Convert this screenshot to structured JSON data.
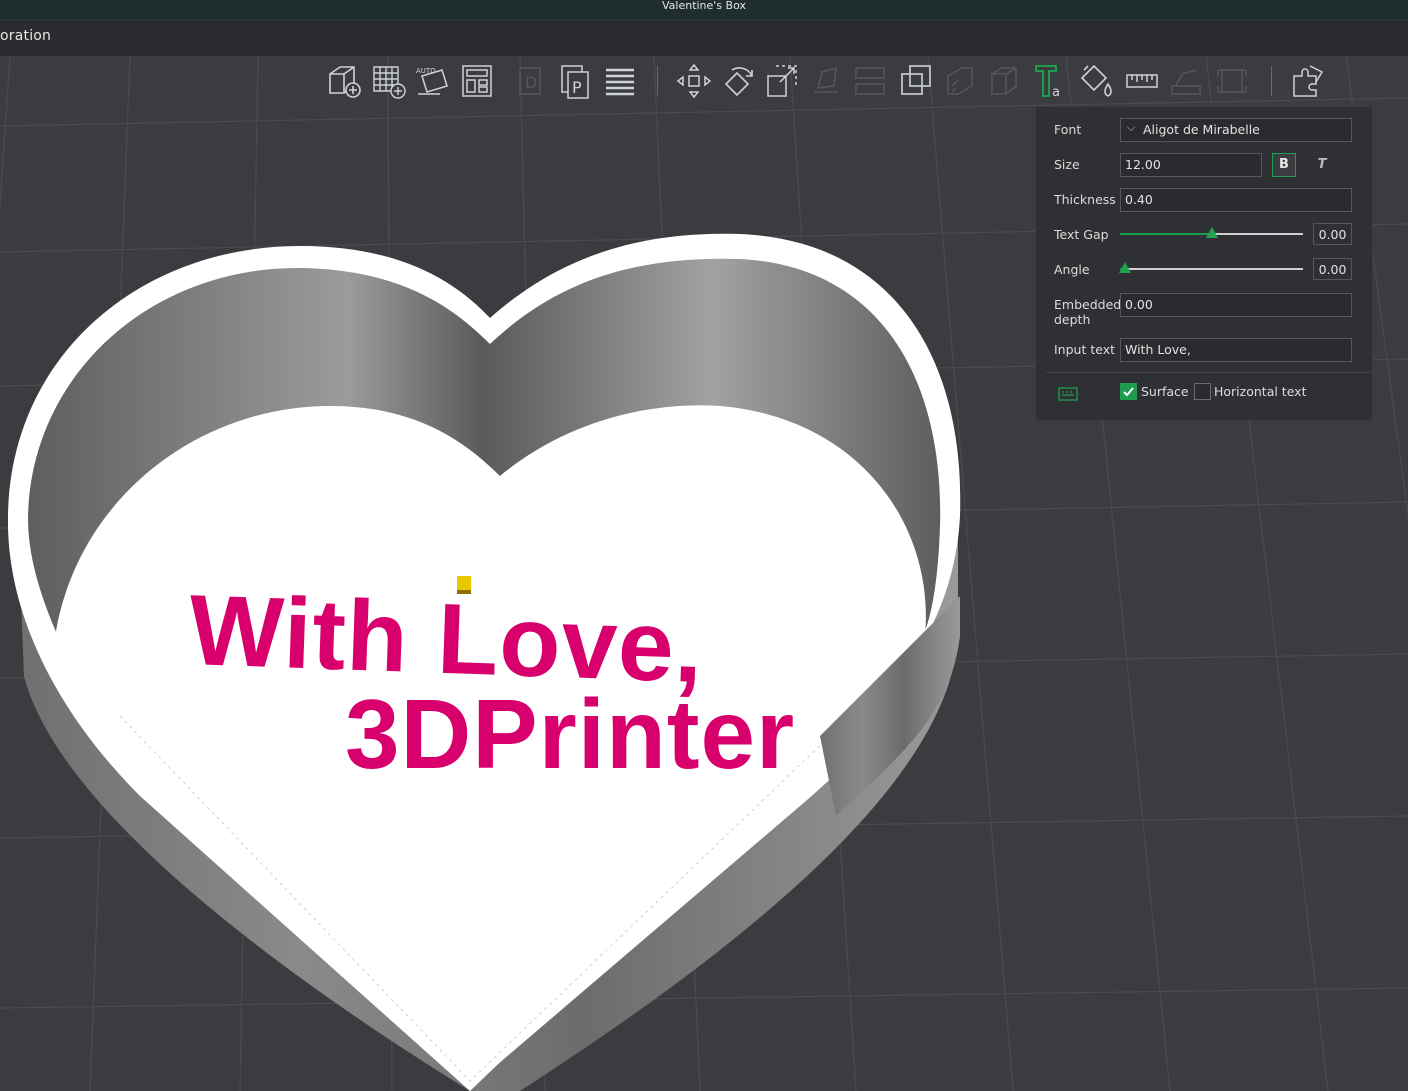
{
  "window": {
    "title": "Valentine's Box"
  },
  "tabbar": {
    "tab_label": "oration"
  },
  "toolbar": {
    "tools": [
      {
        "name": "add-object-icon"
      },
      {
        "name": "add-plate-icon"
      },
      {
        "name": "auto-orient-icon"
      },
      {
        "name": "arrange-icon"
      },
      {
        "name": "split-objects-icon"
      },
      {
        "name": "split-parts-icon"
      },
      {
        "name": "layers-icon"
      },
      {
        "name": "move-icon"
      },
      {
        "name": "rotate-icon"
      },
      {
        "name": "scale-icon"
      },
      {
        "name": "place-on-face-icon"
      },
      {
        "name": "cut-icon"
      },
      {
        "name": "boolean-icon"
      },
      {
        "name": "support-paint-icon"
      },
      {
        "name": "seam-paint-icon"
      },
      {
        "name": "text-emboss-icon"
      },
      {
        "name": "color-paint-icon"
      },
      {
        "name": "measure-icon"
      },
      {
        "name": "brim-ears-icon"
      },
      {
        "name": "assembly-icon"
      },
      {
        "name": "assembly-view-icon"
      }
    ]
  },
  "text_panel": {
    "font_label": "Font",
    "font_value": "Aligot de Mirabelle",
    "size_label": "Size",
    "size_value": "12.00",
    "bold_label": "B",
    "italic_label": "T",
    "thickness_label": "Thickness",
    "thickness_value": "0.40",
    "text_gap_label": "Text Gap",
    "text_gap_value": "0.00",
    "text_gap_slider_fraction": 0.5,
    "angle_label": "Angle",
    "angle_value": "0.00",
    "angle_slider_fraction": 0.03,
    "embedded_label_1": "Embedded",
    "embedded_label_2": "depth",
    "embedded_value": "0.00",
    "input_text_label": "Input text",
    "input_text_value": "With Love,",
    "surface_label": "Surface",
    "surface_checked": true,
    "horizontal_label": "Horizontal text",
    "horizontal_checked": false
  },
  "model": {
    "line1": "With Love,",
    "line2": "3DPrinter",
    "text_color": "#d8006c"
  },
  "colors": {
    "accent": "#1f9d4f",
    "background": "#3b3c3f",
    "panel": "#2f3033"
  }
}
